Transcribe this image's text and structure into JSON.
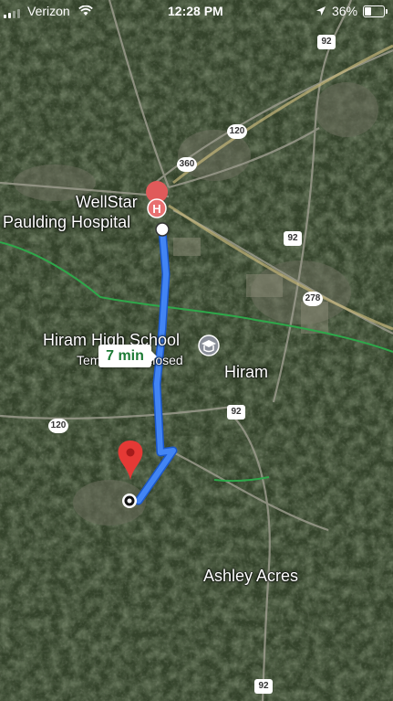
{
  "status_bar": {
    "carrier": "Verizon",
    "time": "12:28 PM",
    "battery": "36%"
  },
  "map": {
    "labels": {
      "hospital_line1": "WellStar",
      "hospital_line2": "Paulding Hospital",
      "school_line1": "Hiram High School",
      "school_line2": "Temporarily closed",
      "hiram": "Hiram",
      "ashley_acres": "Ashley Acres"
    },
    "shields": {
      "s92_top": "92",
      "s120_top": "120",
      "s360": "360",
      "s92_mid": "92",
      "s278": "278",
      "s120_left": "120",
      "s92_center": "92",
      "s92_bottom": "92"
    },
    "route_eta": "7 min"
  },
  "colors": {
    "route": "#4285f4",
    "destination_pin": "#e53935",
    "eta_text": "#1d7a35",
    "rail_line": "#2ea84a"
  },
  "icons": [
    "hospital-icon",
    "school-icon",
    "destination-pin-icon",
    "origin-marker-icon",
    "location-arrow-icon"
  ]
}
